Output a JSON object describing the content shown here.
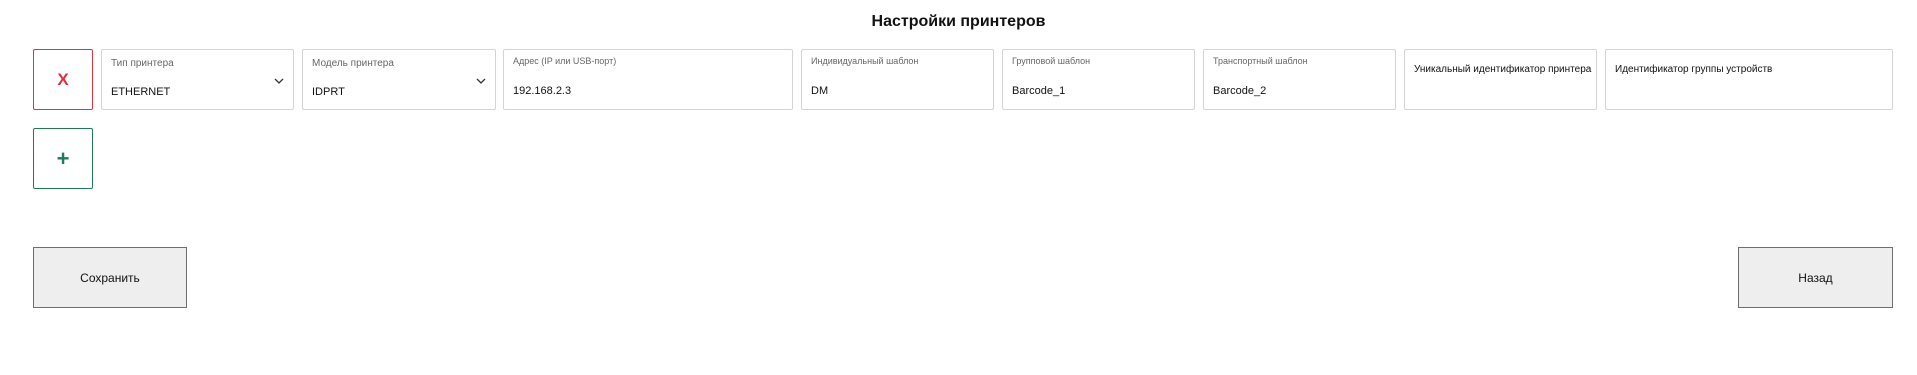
{
  "page": {
    "title": "Настройки принтеров"
  },
  "printer_row": {
    "remove_label": "X",
    "add_label": "+",
    "fields": {
      "printer_type": {
        "label": "Тип принтера",
        "value": "ETHERNET"
      },
      "printer_model": {
        "label": "Модель принтера",
        "value": "IDPRT"
      },
      "address": {
        "label": "Адрес (IP или USB-порт)",
        "value": "192.168.2.3"
      },
      "individual_template": {
        "label": "Индивидуальный шаблон",
        "value": "DM"
      },
      "group_template": {
        "label": "Групповой шаблон",
        "value": "Barcode_1"
      },
      "transport_template": {
        "label": "Транспортный шаблон",
        "value": "Barcode_2"
      },
      "printer_id": {
        "placeholder": "Уникальный идентификатор принтера"
      },
      "device_group_id": {
        "placeholder": "Идентификатор группы устройств"
      }
    }
  },
  "actions": {
    "save_label": "Сохранить",
    "back_label": "Назад"
  },
  "colors": {
    "remove_accent": "#d9363e",
    "add_accent": "#1f7a55",
    "button_bg": "#eeeeee",
    "field_border": "#d4d4d4"
  },
  "icons": {
    "select_arrow": "chevron-down-icon"
  }
}
